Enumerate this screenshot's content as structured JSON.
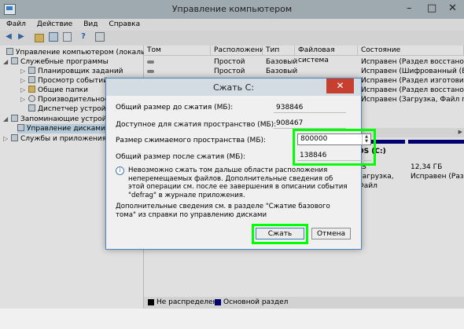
{
  "window": {
    "title": "Управление компьютером",
    "minimize": "–",
    "maximize": "□",
    "close": "✕"
  },
  "menu": [
    "Файл",
    "Действие",
    "Вид",
    "Справка"
  ],
  "tree": {
    "root": "Управление компьютером (локальным)",
    "utilities": "Служебные программы",
    "task_scheduler": "Планировщик заданий",
    "event_viewer": "Просмотр событий",
    "shared_folders": "Общие папки",
    "performance": "Производительность",
    "device_manager": "Диспетчер устройств",
    "storage": "Запоминающие устройст",
    "disk_management": "Управление дисками",
    "services": "Службы и приложения"
  },
  "volume_list": {
    "columns": [
      "Том",
      "Расположение",
      "Тип",
      "Файловая система",
      "Состояние"
    ],
    "rows": [
      {
        "location": "Простой",
        "type": "Базовый",
        "fs": "",
        "status": "Исправен (Раздел восстановлени"
      },
      {
        "location": "Простой",
        "type": "Базовый",
        "fs": "",
        "status": "Исправен (Шифрованный (EFI) с"
      },
      {
        "location": "",
        "type": "",
        "fs": "",
        "status": "Исправен (Раздел изготовителя с"
      },
      {
        "location": "",
        "type": "",
        "fs": "",
        "status": "Исправен (Раздел восстановлени"
      },
      {
        "location": "",
        "type": "",
        "fs": "",
        "status": "Исправен (Загрузка, Файл подкач"
      }
    ]
  },
  "disk_partitions": [
    {
      "name": "OS (C:)",
      "fs": "FS",
      "status": "Загрузка, Файл"
    },
    {
      "size": "12,34 ГБ",
      "status": "Исправен (Разде"
    }
  ],
  "legend": {
    "unallocated": "Не распределена",
    "primary": "Основной раздел",
    "unallocated_color": "#000000",
    "primary_color": "#000080"
  },
  "dialog": {
    "title": "Сжать C:",
    "close": "✕",
    "total_before_label": "Общий размер до сжатия (МБ):",
    "total_before_value": "938846",
    "available_label": "Доступное для сжатия пространство (МБ):",
    "available_value": "908467",
    "shrink_label": "Размер сжимаемого пространства (МБ):",
    "shrink_value": "800000",
    "total_after_label": "Общий размер после сжатия (МБ):",
    "total_after_value": "138846",
    "info_text": "Невозможно сжать том дальше области расположения неперемещаемых файлов. Дополнительные сведения об этой операции см. после ее завершения в описании события \"defrag\" в журнале приложения.",
    "more_text": "Дополнительные сведения см. в разделе \"Сжатие базового тома\" из справки по управлению дисками",
    "shrink_button": "Сжать",
    "cancel_button": "Отмена"
  },
  "highlight_color": "#00ff00"
}
